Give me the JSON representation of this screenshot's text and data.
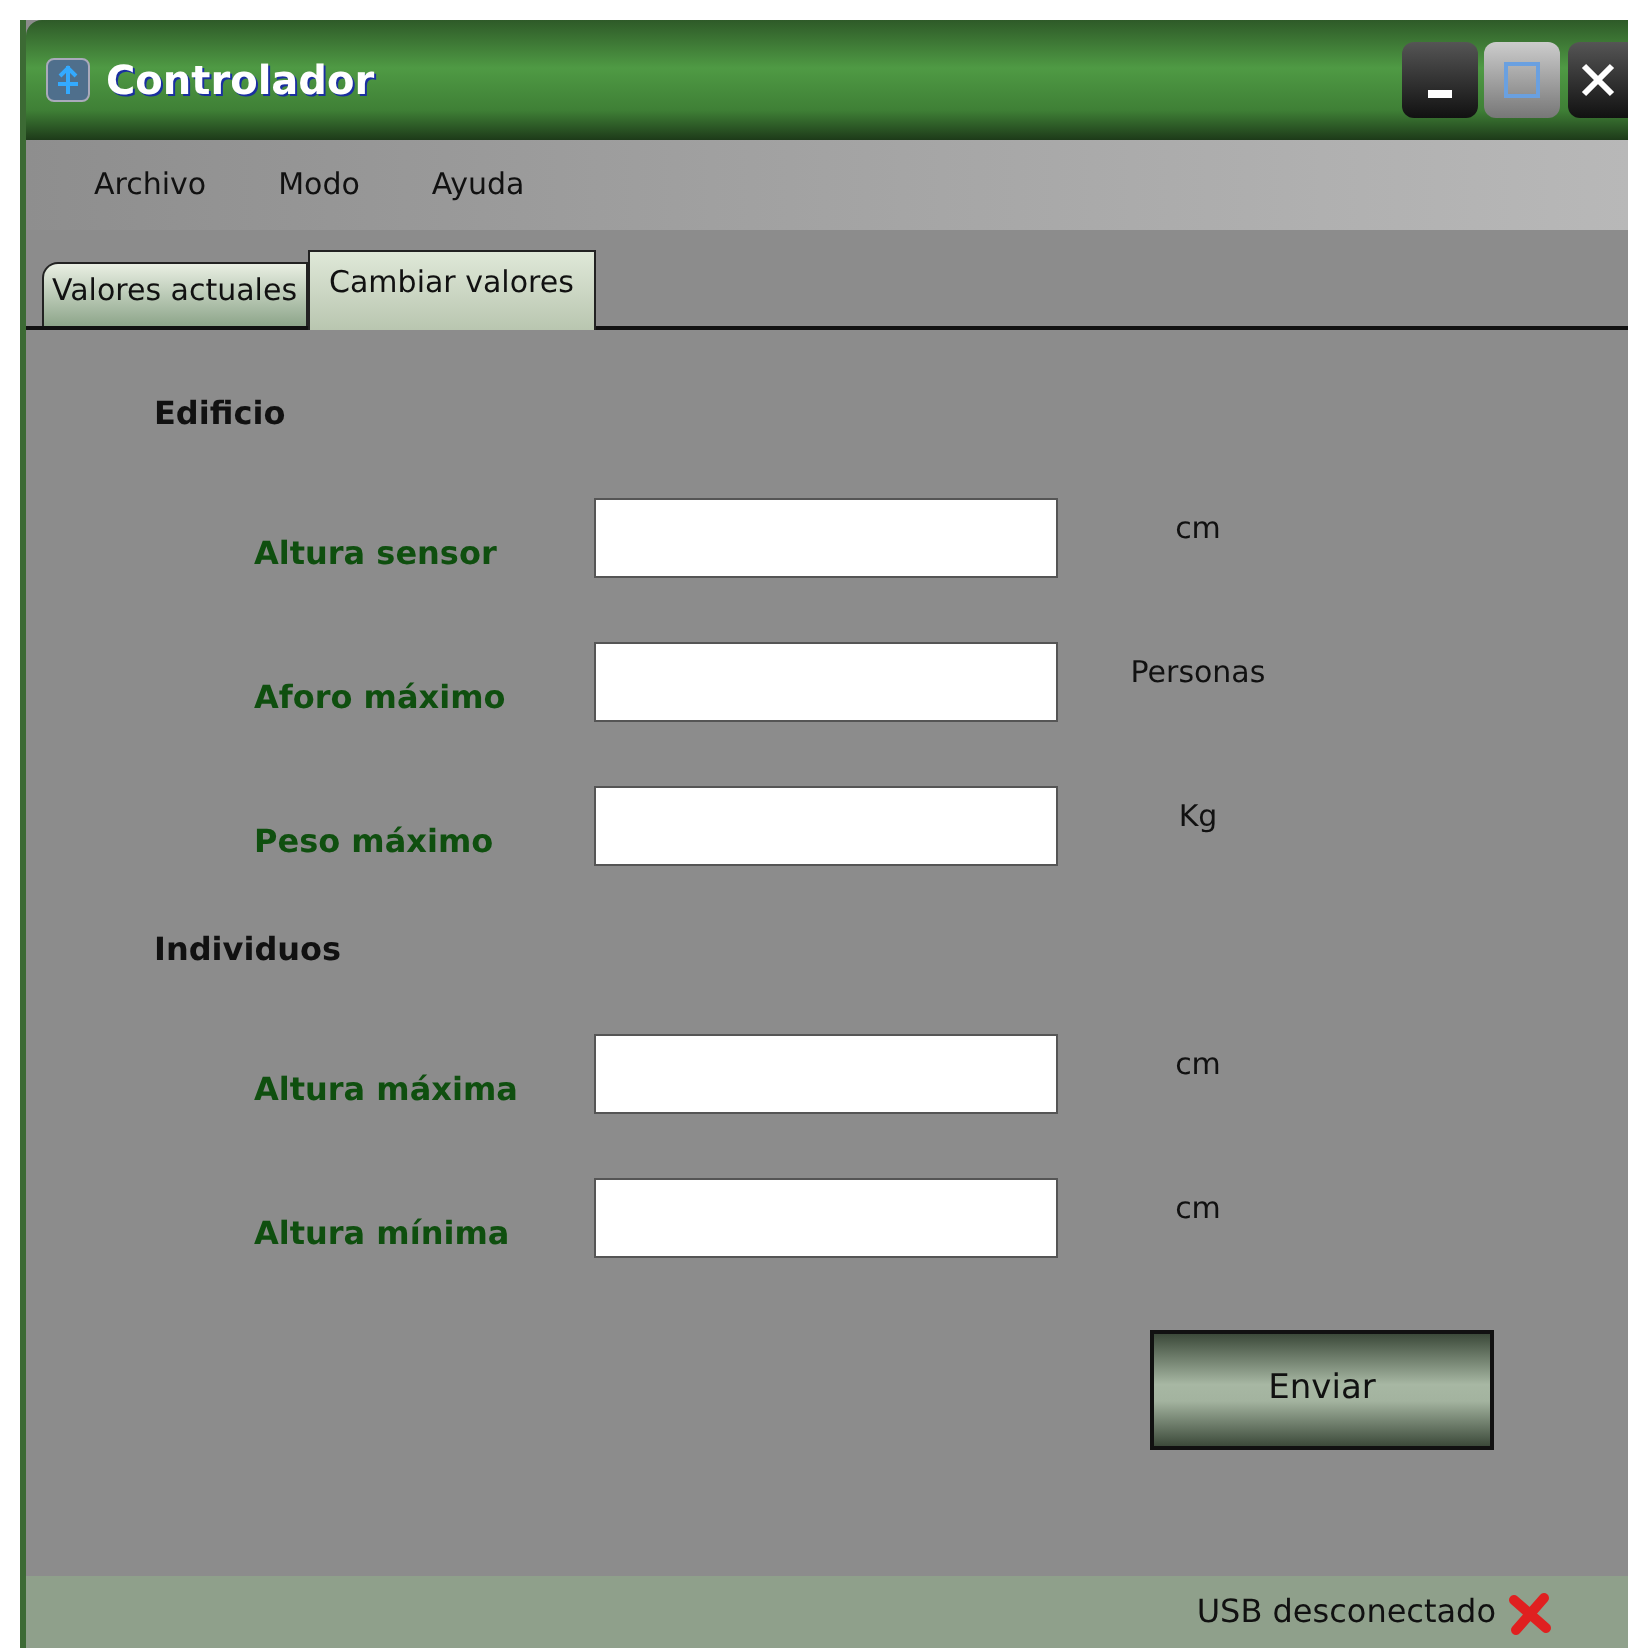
{
  "window": {
    "title": "Controlador"
  },
  "menu": [
    "Archivo",
    "Modo",
    "Ayuda"
  ],
  "tabs": [
    {
      "label": "Valores actuales",
      "selected": false
    },
    {
      "label": "Cambiar valores",
      "selected": true
    }
  ],
  "sections": [
    {
      "title": "Edificio",
      "fields": [
        {
          "label": "Altura sensor",
          "unit": "cm"
        },
        {
          "label": "Aforo máximo",
          "unit": "Personas"
        },
        {
          "label": "Peso máximo",
          "unit": "Kg"
        }
      ]
    },
    {
      "title": "Individuos",
      "fields": [
        {
          "label": "Altura máxima",
          "unit": "cm"
        },
        {
          "label": "Altura mínima",
          "unit": "cm"
        }
      ]
    }
  ],
  "submit": "Enviar",
  "status_bar": {
    "text": "USB desconectado",
    "connected": false
  }
}
